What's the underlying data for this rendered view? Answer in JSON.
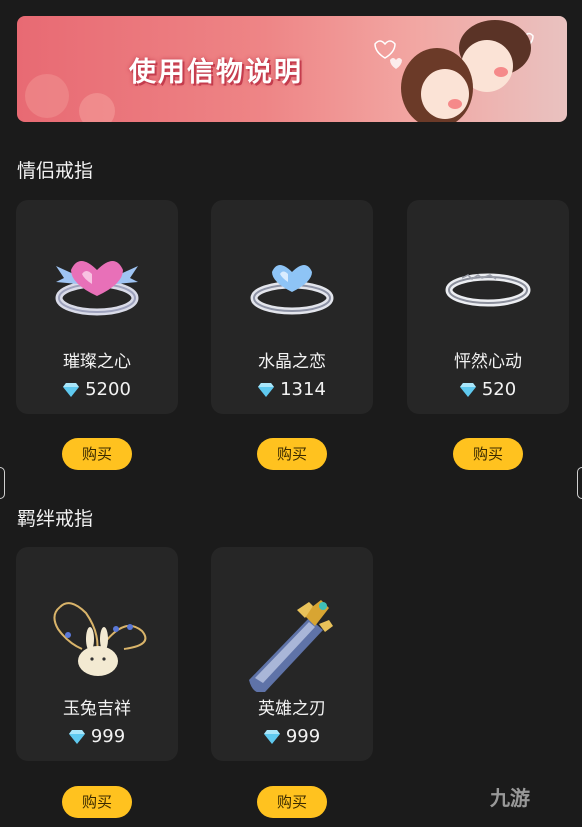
{
  "banner": {
    "title": "使用信物说明"
  },
  "sections": [
    {
      "title": "情侣戒指",
      "items": [
        {
          "name": "璀璨之心",
          "price": "5200",
          "buy_label": "购买",
          "icon": "pink-heart-winged-ring"
        },
        {
          "name": "水晶之恋",
          "price": "1314",
          "buy_label": "购买",
          "icon": "blue-heart-ring"
        },
        {
          "name": "怦然心动",
          "price": "520",
          "buy_label": "购买",
          "icon": "silver-band-ring"
        }
      ]
    },
    {
      "title": "羁绊戒指",
      "items": [
        {
          "name": "玉兔吉祥",
          "price": "999",
          "buy_label": "购买",
          "icon": "jade-rabbit-charm"
        },
        {
          "name": "英雄之刃",
          "price": "999",
          "buy_label": "购买",
          "icon": "hero-sword"
        }
      ]
    }
  ],
  "watermark": "九游",
  "colors": {
    "background": "#1b1b1b",
    "card": "#262626",
    "buy_button": "#ffc21f",
    "diamond": "#5fc9ef",
    "banner": "#ee8586"
  }
}
